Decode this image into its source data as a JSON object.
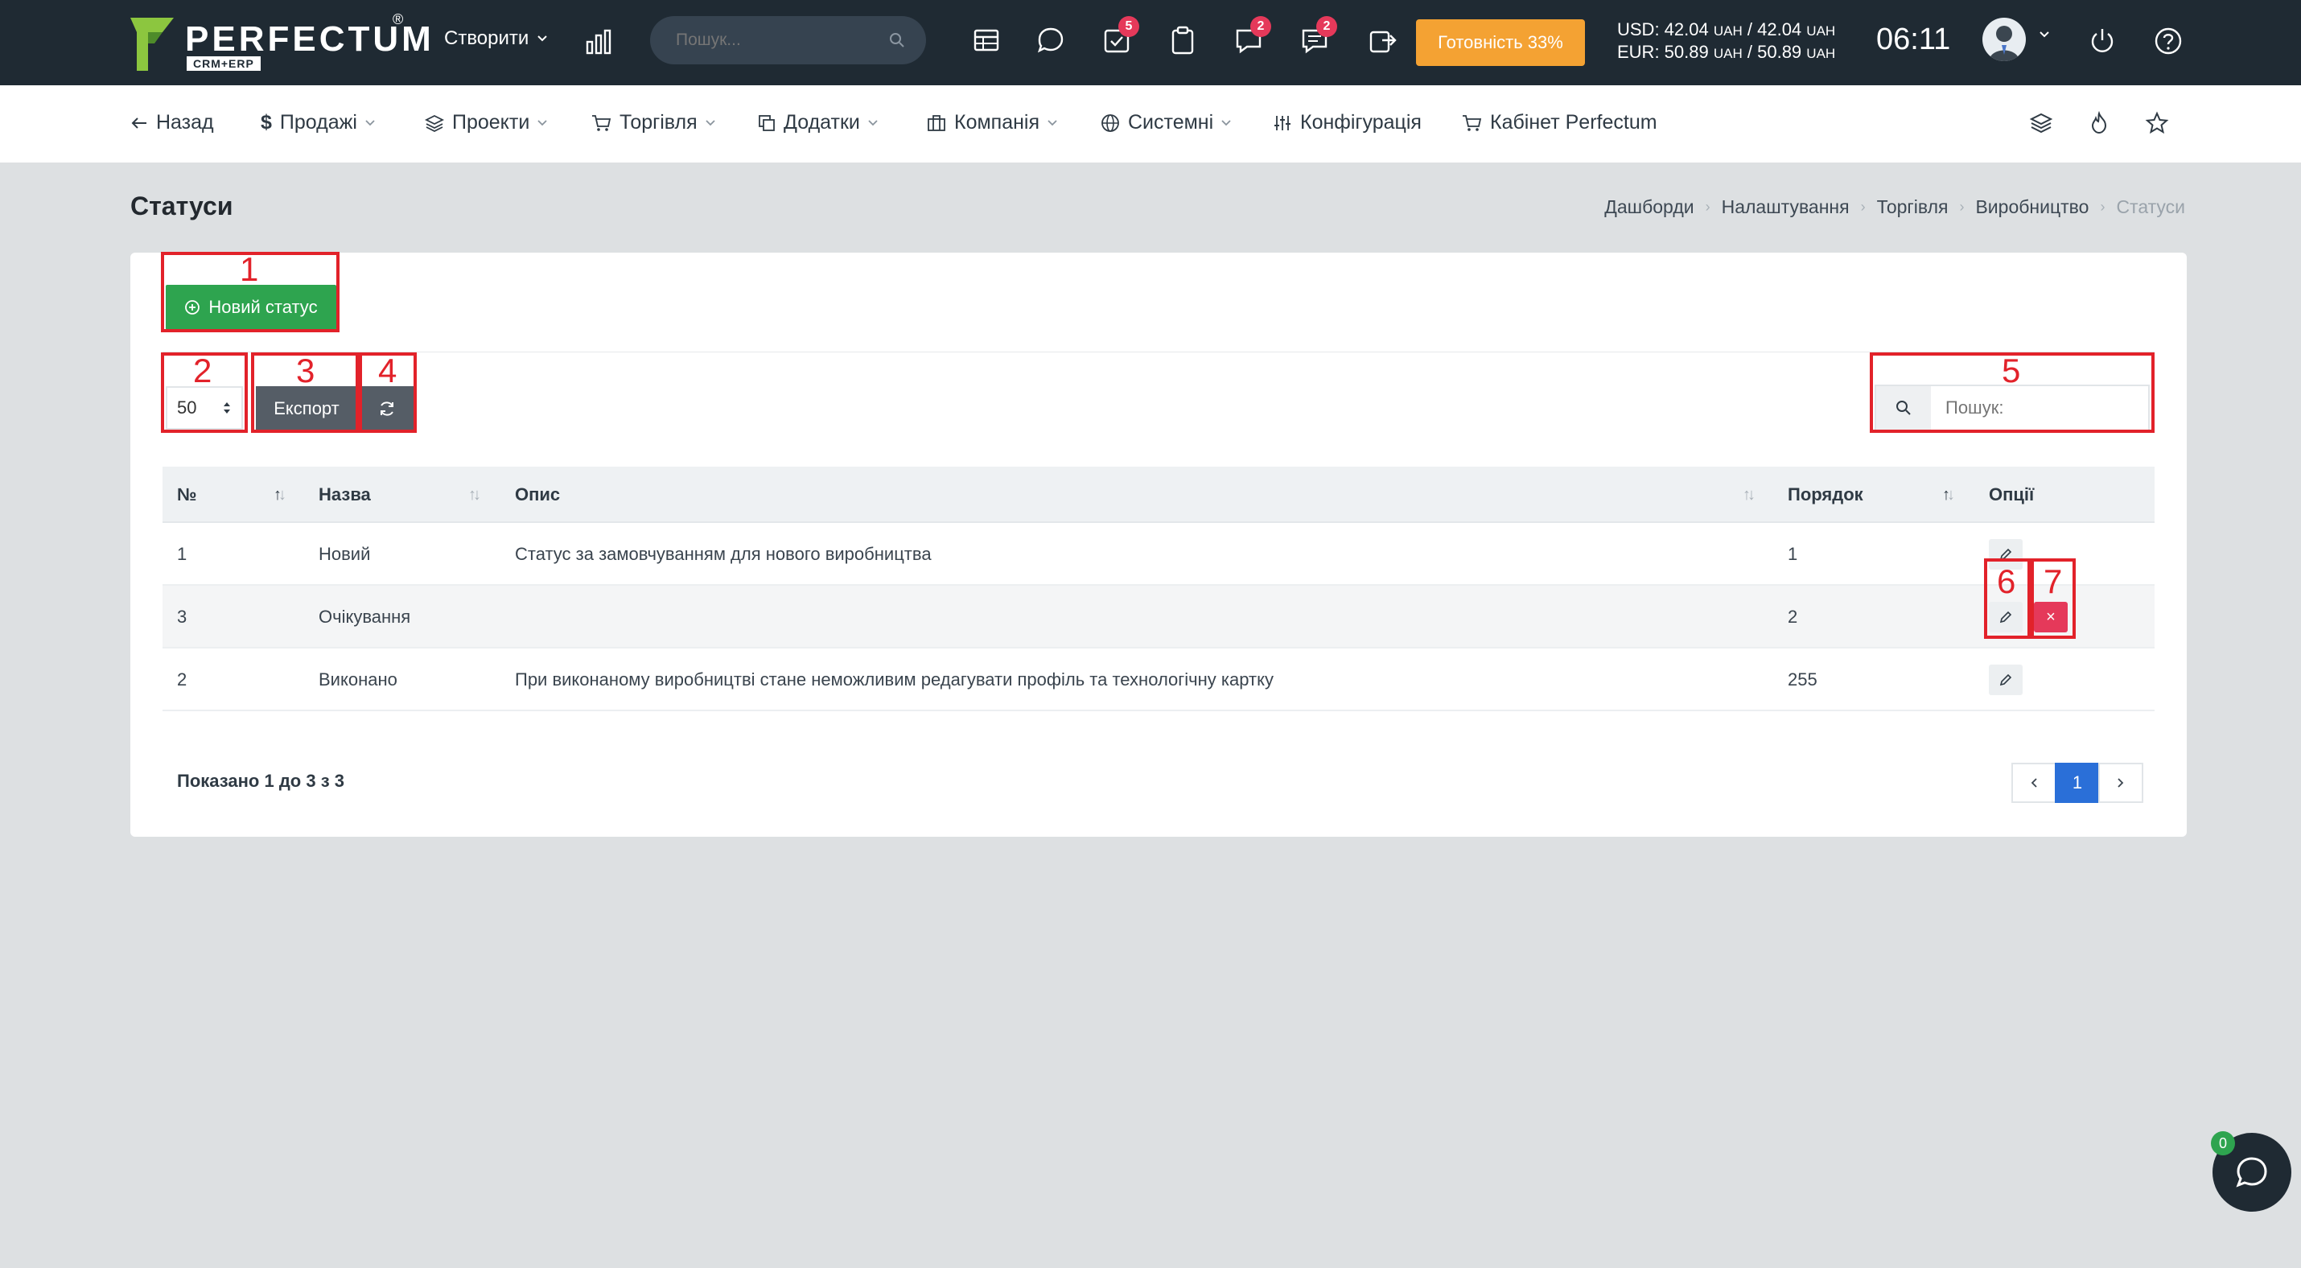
{
  "header": {
    "logo_text": "PERFECTUM",
    "logo_sub": "CRM+ERP",
    "logo_reg": "®",
    "create_label": "Створити",
    "search_placeholder": "Пошук...",
    "badges": {
      "tasks": "5",
      "chat": "2",
      "messages": "2"
    },
    "readiness_label": "Готовність 33%",
    "usd_line": {
      "prefix": "USD: 42.04",
      "unit1": "UAH",
      "mid": "/ 42.04",
      "unit2": "UAH"
    },
    "eur_line": {
      "prefix": "EUR: 50.89",
      "unit1": "UAH",
      "mid": "/ 50.89",
      "unit2": "UAH"
    },
    "clock": "06:11"
  },
  "nav": {
    "back": "Назад",
    "sales": "Продажі",
    "projects": "Проекти",
    "trade": "Торгівля",
    "addons": "Додатки",
    "company": "Компанія",
    "system": "Системні",
    "config": "Конфігурація",
    "cabinet": "Кабінет Perfectum"
  },
  "page": {
    "title": "Статуси",
    "breadcrumb": [
      "Дашборди",
      "Налаштування",
      "Торгівля",
      "Виробництво",
      "Статуси"
    ]
  },
  "toolbar": {
    "new_status_label": "Новий статус",
    "page_size": "50",
    "export_label": "Експорт",
    "search_placeholder": "Пошук:"
  },
  "annotations": [
    "1",
    "2",
    "3",
    "4",
    "5",
    "6",
    "7"
  ],
  "table": {
    "headers": {
      "num": "№",
      "name": "Назва",
      "desc": "Опис",
      "order": "Порядок",
      "options": "Опції"
    },
    "rows": [
      {
        "num": "1",
        "name": "Новий",
        "desc": "Статус за замовчуванням для нового виробництва",
        "order": "1"
      },
      {
        "num": "3",
        "name": "Очікування",
        "desc": "",
        "order": "2"
      },
      {
        "num": "2",
        "name": "Виконано",
        "desc": "При виконаному виробництві стане неможливим редагувати профіль та технологічну картку",
        "order": "255"
      }
    ],
    "showing": "Показано 1 до 3 з 3",
    "current_page": "1"
  },
  "chat": {
    "badge": "0"
  },
  "colors": {
    "topbar": "#1f2a33",
    "accent_green": "#2ea44f",
    "accent_orange": "#f4a233",
    "danger": "#e5395a",
    "annotation": "#e2222a",
    "pager_active": "#2a6fd8"
  }
}
